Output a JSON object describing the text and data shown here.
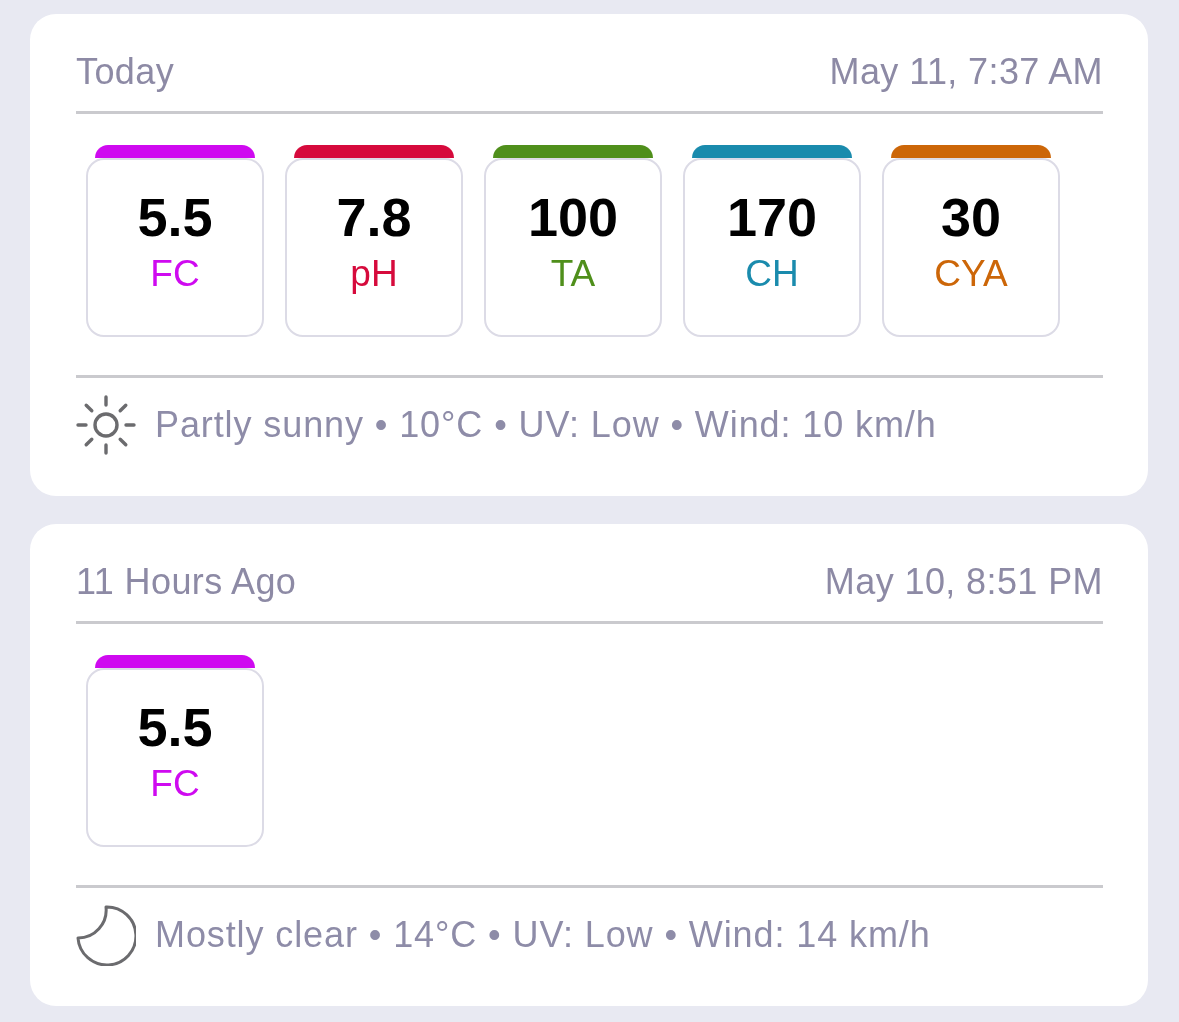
{
  "log_entries": [
    {
      "title": "Today",
      "timestamp": "May 11, 7:37 AM",
      "readings": [
        {
          "value": "5.5",
          "label": "FC",
          "color": "#cf0af0"
        },
        {
          "value": "7.8",
          "label": "pH",
          "color": "#d60a3c"
        },
        {
          "value": "100",
          "label": "TA",
          "color": "#4f8f1b"
        },
        {
          "value": "170",
          "label": "CH",
          "color": "#1a8bad"
        },
        {
          "value": "30",
          "label": "CYA",
          "color": "#cc6608"
        }
      ],
      "weather": {
        "kind": "sun",
        "text": "Partly sunny • 10°C • UV: Low • Wind: 10 km/h"
      }
    },
    {
      "title": "11 Hours Ago",
      "timestamp": "May 10, 8:51 PM",
      "readings": [
        {
          "value": "5.5",
          "label": "FC",
          "color": "#cf0af0"
        }
      ],
      "weather": {
        "kind": "moon",
        "text": "Mostly clear • 14°C • UV: Low • Wind: 14 km/h"
      }
    }
  ]
}
